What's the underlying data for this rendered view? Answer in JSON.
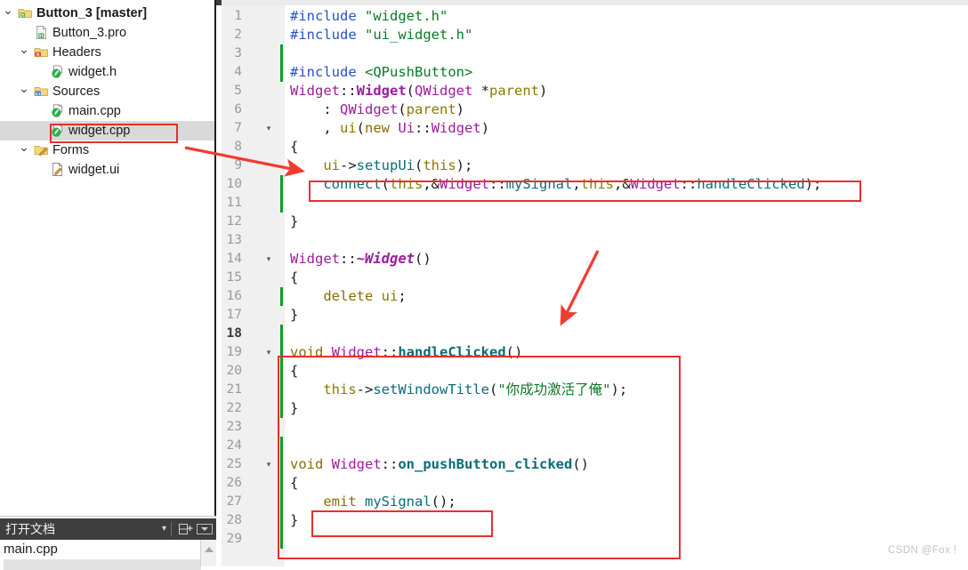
{
  "window": {
    "accent_red": "#e8302a",
    "selection_gray": "#d9d9d9"
  },
  "sidebar": {
    "tree": [
      {
        "label": "Button_3 [master]",
        "icon": "qt-folder-icon",
        "twisty": "chevron-down-icon",
        "depth": 0,
        "bold": true,
        "selected": false
      },
      {
        "label": "Button_3.pro",
        "icon": "qt-project-file-icon",
        "twisty": "",
        "depth": 1,
        "bold": false,
        "selected": false
      },
      {
        "label": "Headers",
        "icon": "headers-folder-icon",
        "twisty": "chevron-down-icon",
        "depth": 1,
        "bold": false,
        "selected": false
      },
      {
        "label": "widget.h",
        "icon": "header-file-icon",
        "twisty": "",
        "depth": 2,
        "bold": false,
        "selected": false
      },
      {
        "label": "Sources",
        "icon": "sources-folder-icon",
        "twisty": "chevron-down-icon",
        "depth": 1,
        "bold": false,
        "selected": false
      },
      {
        "label": "main.cpp",
        "icon": "cpp-file-icon",
        "twisty": "",
        "depth": 2,
        "bold": false,
        "selected": false
      },
      {
        "label": "widget.cpp",
        "icon": "cpp-file-icon",
        "twisty": "",
        "depth": 2,
        "bold": false,
        "selected": true
      },
      {
        "label": "Forms",
        "icon": "forms-folder-icon",
        "twisty": "chevron-down-icon",
        "depth": 1,
        "bold": false,
        "selected": false
      },
      {
        "label": "widget.ui",
        "icon": "ui-form-file-icon",
        "twisty": "",
        "depth": 2,
        "bold": false,
        "selected": false
      }
    ]
  },
  "open_documents": {
    "title": "打开文档",
    "caret": "▾",
    "split_icon": "split-view-icon",
    "close_icon": "close-panel-icon",
    "items": [
      "main.cpp"
    ]
  },
  "editor": {
    "lines": [
      {
        "n": "1",
        "fold": "",
        "changed": false,
        "current": false
      },
      {
        "n": "2",
        "fold": "",
        "changed": false,
        "current": false
      },
      {
        "n": "3",
        "fold": "",
        "changed": true,
        "current": false
      },
      {
        "n": "4",
        "fold": "",
        "changed": true,
        "current": false
      },
      {
        "n": "5",
        "fold": "",
        "changed": false,
        "current": false
      },
      {
        "n": "6",
        "fold": "",
        "changed": false,
        "current": false
      },
      {
        "n": "7",
        "fold": "▾",
        "changed": false,
        "current": false
      },
      {
        "n": "8",
        "fold": "",
        "changed": false,
        "current": false
      },
      {
        "n": "9",
        "fold": "",
        "changed": false,
        "current": false
      },
      {
        "n": "10",
        "fold": "",
        "changed": true,
        "current": false
      },
      {
        "n": "11",
        "fold": "",
        "changed": true,
        "current": false
      },
      {
        "n": "12",
        "fold": "",
        "changed": false,
        "current": false
      },
      {
        "n": "13",
        "fold": "",
        "changed": false,
        "current": false
      },
      {
        "n": "14",
        "fold": "▾",
        "changed": false,
        "current": false
      },
      {
        "n": "15",
        "fold": "",
        "changed": false,
        "current": false
      },
      {
        "n": "16",
        "fold": "",
        "changed": true,
        "current": false
      },
      {
        "n": "17",
        "fold": "",
        "changed": false,
        "current": false
      },
      {
        "n": "18",
        "fold": "",
        "changed": true,
        "current": true
      },
      {
        "n": "19",
        "fold": "▾",
        "changed": true,
        "current": false
      },
      {
        "n": "20",
        "fold": "",
        "changed": true,
        "current": false
      },
      {
        "n": "21",
        "fold": "",
        "changed": true,
        "current": false
      },
      {
        "n": "22",
        "fold": "",
        "changed": true,
        "current": false
      },
      {
        "n": "23",
        "fold": "",
        "changed": false,
        "current": false
      },
      {
        "n": "24",
        "fold": "",
        "changed": true,
        "current": false
      },
      {
        "n": "25",
        "fold": "▾",
        "changed": true,
        "current": false
      },
      {
        "n": "26",
        "fold": "",
        "changed": true,
        "current": false
      },
      {
        "n": "27",
        "fold": "",
        "changed": true,
        "current": false
      },
      {
        "n": "28",
        "fold": "",
        "changed": true,
        "current": false
      },
      {
        "n": "29",
        "fold": "",
        "changed": true,
        "current": false
      }
    ],
    "code": [
      "#include \"widget.h\"",
      "#include \"ui_widget.h\"",
      "",
      "#include <QPushButton>",
      "Widget::Widget(QWidget *parent)",
      "    : QWidget(parent)",
      "    , ui(new Ui::Widget)",
      "{",
      "    ui->setupUi(this);",
      "    connect(this,&Widget::mySignal,this,&Widget::handleClicked);",
      "",
      "}",
      "",
      "Widget::~Widget()",
      "{",
      "    delete ui;",
      "}",
      "",
      "void Widget::handleClicked()",
      "{",
      "    this->setWindowTitle(\"你成功激活了俺\");",
      "}",
      "",
      "",
      "void Widget::on_pushButton_clicked()",
      "{",
      "    emit mySignal();",
      "}",
      ""
    ]
  },
  "annotations": {
    "boxes": [
      {
        "name": "connect-line-highlight"
      },
      {
        "name": "handle-clicked-block-highlight"
      },
      {
        "name": "emit-signal-highlight"
      },
      {
        "name": "widget-cpp-selection-highlight"
      }
    ],
    "arrows": [
      {
        "name": "arrow-from-widget-cpp-to-connect"
      },
      {
        "name": "arrow-to-handle-clicked"
      }
    ]
  },
  "watermark": {
    "text": "CSDN @Fox !"
  }
}
